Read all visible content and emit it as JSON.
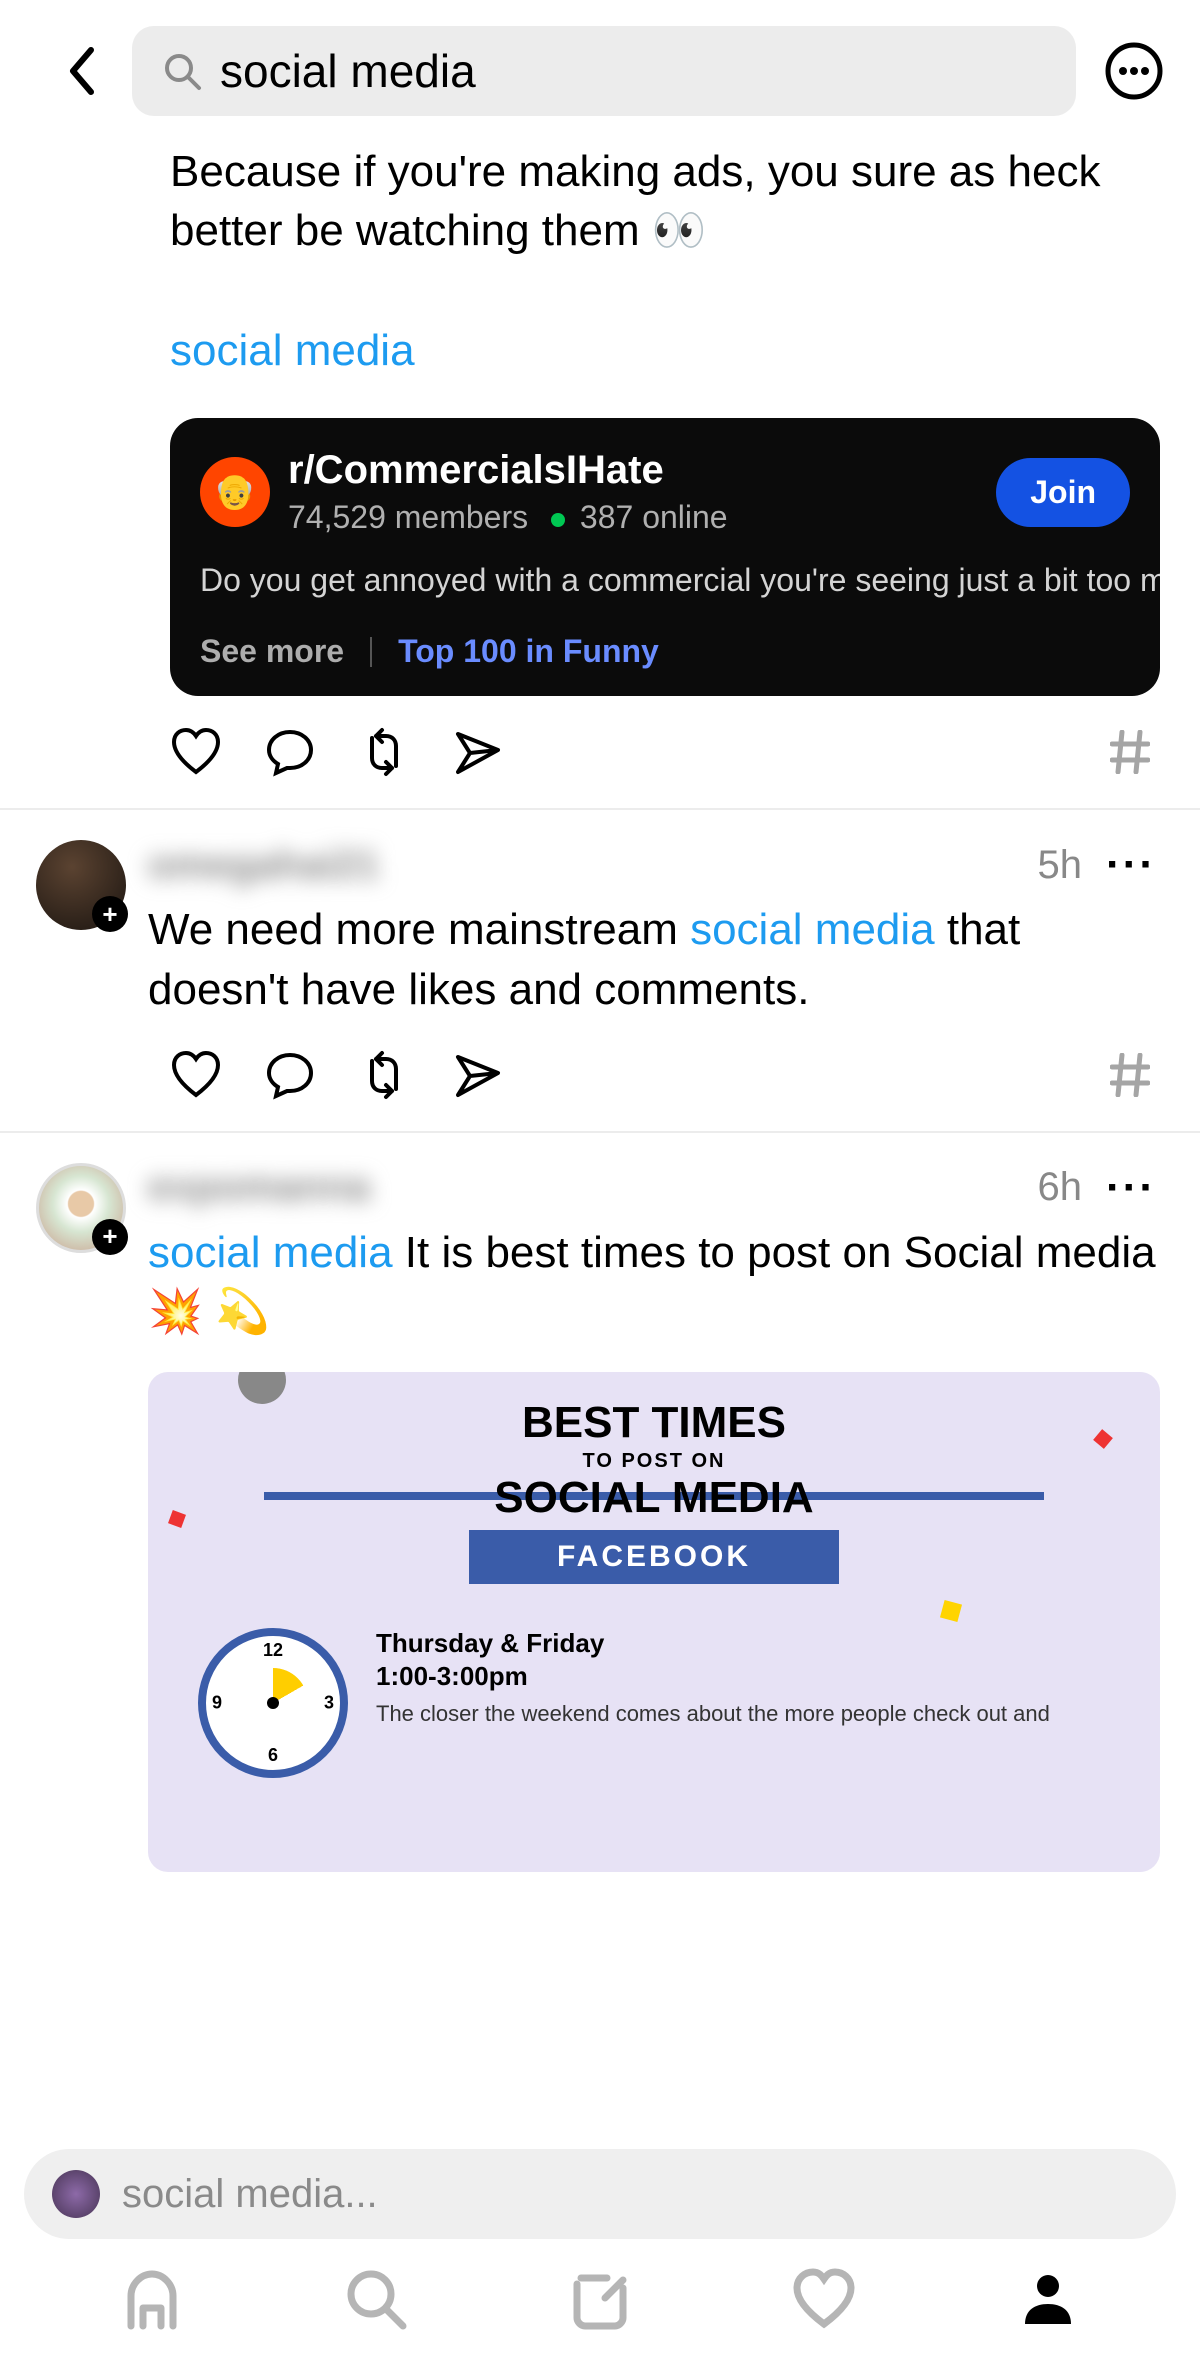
{
  "header": {
    "search_value": "social media"
  },
  "posts": [
    {
      "body_pre": "Because if you're making ads, you sure as heck better be watching them 👀",
      "highlight": "social media",
      "card": {
        "name": "r/CommercialsIHate",
        "members": "74,529 members",
        "online": "387 online",
        "join": "Join",
        "desc": "Do you get annoyed with a commercial you're seeing just a bit too muc",
        "see_more": "See more",
        "top": "Top 100 in Funny"
      }
    },
    {
      "username": "omegahai21",
      "time": "5h",
      "text_pre": "We need more mainstream ",
      "highlight": "social media",
      "text_post": "  that doesn't have likes and comments."
    },
    {
      "username": "expomanna",
      "time": "6h",
      "highlight": "social media",
      "text_post": " It is best times to post on Social media💥 💫",
      "infographic": {
        "title1": "BEST TIMES",
        "title2": "TO POST ON",
        "title3": "SOCIAL MEDIA",
        "platform": "FACEBOOK",
        "day": "Thursday & Friday",
        "hours": "1:00-3:00pm",
        "note": "The closer the weekend comes about the more people check out and",
        "clock": {
          "highlight_start_hour": 1,
          "highlight_end_hour": 3
        }
      }
    }
  ],
  "compose": {
    "placeholder": "social media..."
  },
  "icons": {
    "back": "chevron-left",
    "overflow": "ellipsis-circle",
    "like": "heart",
    "comment": "chat-bubble",
    "repost": "retweet",
    "share": "paper-plane",
    "tag": "hash"
  }
}
